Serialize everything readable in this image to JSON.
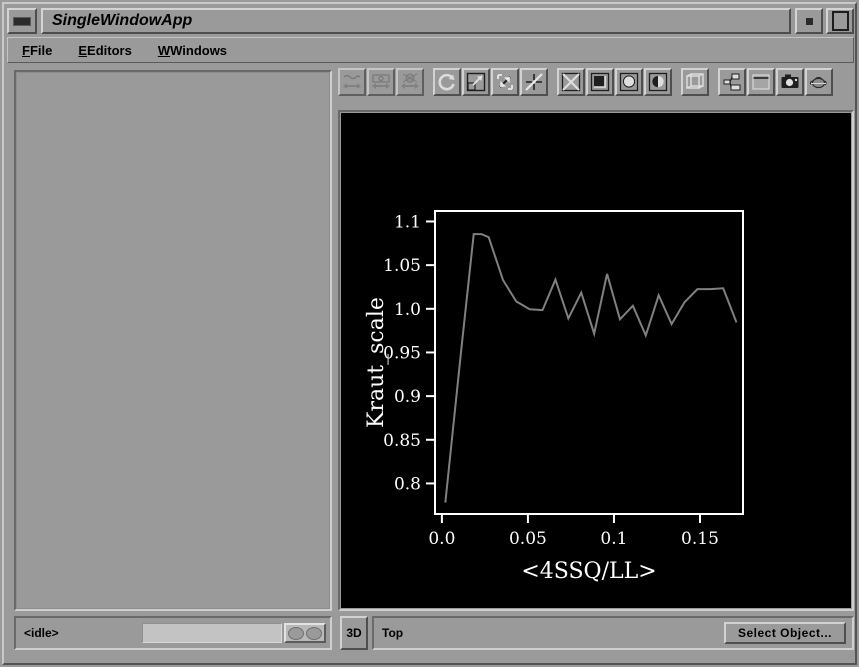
{
  "window": {
    "title": "SingleWindowApp",
    "menu_icon": "window-menu-icon",
    "minimize_icon": "minimize-icon",
    "maximize_icon": "maximize-icon"
  },
  "menubar": {
    "items": [
      {
        "label": "File",
        "mnemonic": "F"
      },
      {
        "label": "Editors",
        "mnemonic": "E"
      },
      {
        "label": "Windows",
        "mnemonic": "W"
      }
    ]
  },
  "toolbar": {
    "buttons": [
      {
        "name": "view-prev-icon",
        "enabled": false
      },
      {
        "name": "view-home-icon",
        "enabled": false
      },
      {
        "name": "view-next-icon",
        "enabled": false
      },
      {
        "name": "rotate-icon",
        "enabled": true
      },
      {
        "name": "zoom-box-icon",
        "enabled": true
      },
      {
        "name": "zoom-out-icon",
        "enabled": true
      },
      {
        "name": "pan-icon",
        "enabled": true
      },
      {
        "name": "wireframe-icon",
        "enabled": true
      },
      {
        "name": "flat-shade-icon",
        "enabled": true
      },
      {
        "name": "smooth-shade-icon",
        "enabled": true
      },
      {
        "name": "half-shade-icon",
        "enabled": true
      },
      {
        "name": "bounding-box-icon",
        "enabled": true
      },
      {
        "name": "graph-icon",
        "enabled": true
      },
      {
        "name": "clear-window-icon",
        "enabled": true
      },
      {
        "name": "snapshot-camera-icon",
        "enabled": true
      },
      {
        "name": "teapot-icon",
        "enabled": true
      }
    ]
  },
  "left_panel": {
    "name": "object-list-panel",
    "content": ""
  },
  "status": {
    "state": "<idle>",
    "progress_value": 0,
    "indicator": "eyes-indicator"
  },
  "viewbar": {
    "mode_button": "3D",
    "view_label": "Top",
    "select_object_label": "Select Object..."
  },
  "chart_data": {
    "type": "line",
    "title": "",
    "xlabel": "<4SSQ/LL>",
    "ylabel": "Kraut_scale",
    "xlim": [
      -0.004,
      0.175
    ],
    "ylim": [
      0.765,
      1.112
    ],
    "xticks": [
      0.0,
      0.05,
      0.1,
      0.15
    ],
    "xtick_labels": [
      "0.0",
      "0.05",
      "0.1",
      "0.15"
    ],
    "yticks": [
      0.8,
      0.85,
      0.9,
      0.95,
      1.0,
      1.05,
      1.1
    ],
    "ytick_labels": [
      "0.8",
      "0.85",
      "0.9",
      "0.95",
      "1.0",
      "1.05",
      "1.1"
    ],
    "grid": false,
    "legend": null,
    "background": "#000000",
    "frame_color": "#ffffff",
    "line_color": "#808080",
    "line_width": 2,
    "series": [
      {
        "name": "Kraut_scale",
        "x": [
          0.002,
          0.0112,
          0.0185,
          0.023,
          0.0272,
          0.0355,
          0.0432,
          0.051,
          0.0585,
          0.066,
          0.0735,
          0.081,
          0.0885,
          0.096,
          0.1035,
          0.111,
          0.1185,
          0.126,
          0.1335,
          0.141,
          0.1485,
          0.156,
          0.1635,
          0.1712
        ],
        "y": [
          0.778,
          0.952,
          1.0855,
          1.0855,
          1.082,
          1.033,
          1.0085,
          0.9995,
          0.9985,
          1.0335,
          0.989,
          1.0185,
          0.9715,
          1.04,
          0.988,
          1.0035,
          0.9695,
          1.0155,
          0.9825,
          1.0075,
          1.0225,
          1.0225,
          1.0235,
          0.9845
        ]
      }
    ]
  }
}
